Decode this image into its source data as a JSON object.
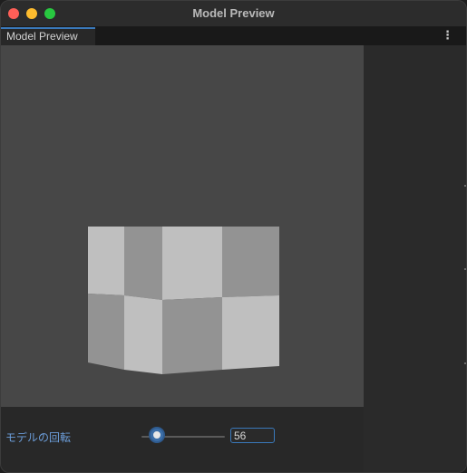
{
  "window": {
    "title": "Model Preview"
  },
  "tabs": [
    {
      "label": "Model Preview",
      "active": true
    }
  ],
  "tab_menu_icon": "kebab-menu-icon",
  "viewport": {
    "background": "#474747",
    "model": "checkered-cube",
    "light_color": "#bfbfbf",
    "dark_color": "#939393"
  },
  "rotation_control": {
    "label": "モデルの回転",
    "value": "56"
  },
  "colors": {
    "accent": "#3a79bb",
    "label_blue": "#6d9fdc",
    "close": "#fe5f57",
    "minimize": "#febc2e",
    "maximize": "#28c840"
  }
}
